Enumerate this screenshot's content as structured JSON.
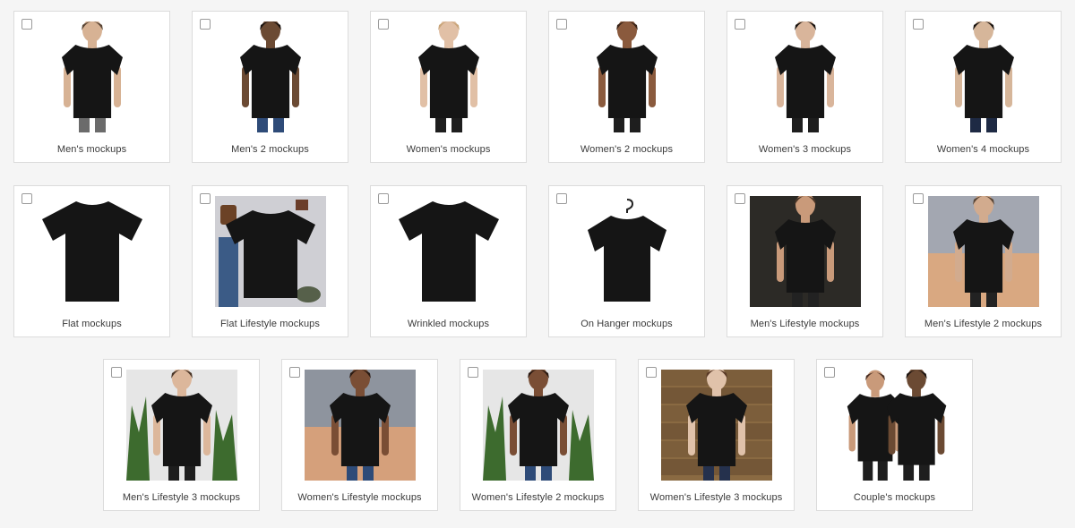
{
  "mockups": [
    {
      "label": "Men's mockups",
      "style": "person",
      "bg": "#ffffff",
      "skin": "#d7b294",
      "hair": "#5a4636",
      "pants": "#6b6b6b"
    },
    {
      "label": "Men's 2 mockups",
      "style": "person",
      "bg": "#ffffff",
      "skin": "#6b4a33",
      "hair": "#1c1410",
      "pants": "#2e4b78"
    },
    {
      "label": "Women's mockups",
      "style": "person",
      "bg": "#ffffff",
      "skin": "#e1c0a6",
      "hair": "#c9a57a",
      "pants": "#1e1e1e"
    },
    {
      "label": "Women's 2 mockups",
      "style": "person",
      "bg": "#ffffff",
      "skin": "#8a5a3d",
      "hair": "#3a2418",
      "pants": "#1e1e1e"
    },
    {
      "label": "Women's 3 mockups",
      "style": "person",
      "bg": "#ffffff",
      "skin": "#d9b59b",
      "hair": "#1a1410",
      "pants": "#1e1e1e"
    },
    {
      "label": "Women's 4 mockups",
      "style": "person",
      "bg": "#ffffff",
      "skin": "#d6b69a",
      "hair": "#1a1410",
      "pants": "#1e2a44"
    },
    {
      "label": "Flat mockups",
      "style": "flat",
      "bg": "#ffffff"
    },
    {
      "label": "Flat Lifestyle mockups",
      "style": "flatlife",
      "bg": "#cfcfd4"
    },
    {
      "label": "Wrinkled mockups",
      "style": "flat",
      "bg": "#ffffff"
    },
    {
      "label": "On Hanger mockups",
      "style": "hanger",
      "bg": "#ffffff"
    },
    {
      "label": "Men's Lifestyle mockups",
      "style": "person",
      "bg": "#2c2a26",
      "skin": "#c99a7a",
      "hair": "#4a3628",
      "pants": "#222222"
    },
    {
      "label": "Men's Lifestyle 2 mockups",
      "style": "person",
      "bg": "#a3a7b1",
      "skin": "#d2ab8e",
      "hair": "#5a4636",
      "pants": "#222222",
      "floor": "#d9a881"
    },
    {
      "label": "Men's Lifestyle 3 mockups",
      "style": "person",
      "bg": "#e6e6e6",
      "skin": "#dcb79b",
      "hair": "#4a3628",
      "pants": "#1e1e1e",
      "plant": "#3d6b2e"
    },
    {
      "label": "Women's Lifestyle mockups",
      "style": "person",
      "bg": "#8e949e",
      "skin": "#7a4e35",
      "hair": "#2a1a12",
      "pants": "#2e4b78",
      "floor": "#d5a07b"
    },
    {
      "label": "Women's Lifestyle 2 mockups",
      "style": "person",
      "bg": "#e6e6e6",
      "skin": "#7a4e35",
      "hair": "#2a1a12",
      "pants": "#2e4b78",
      "plant": "#3d6b2e"
    },
    {
      "label": "Women's Lifestyle 3 mockups",
      "style": "person",
      "bg": "#8a6a42",
      "skin": "#e0c2aa",
      "hair": "#5a3a26",
      "pants": "#25314d",
      "wood": "#6e5234"
    },
    {
      "label": "Couple's mockups",
      "style": "couple",
      "bg": "#ffffff",
      "skin": "#c99a7a",
      "skin2": "#6b4a33",
      "hair": "#4a3024",
      "hair2": "#1c1410",
      "pants": "#1e1e1e"
    }
  ],
  "colors": {
    "card_border": "#dcdcdc",
    "page_bg": "#f5f5f5",
    "shirt": "#151515"
  }
}
